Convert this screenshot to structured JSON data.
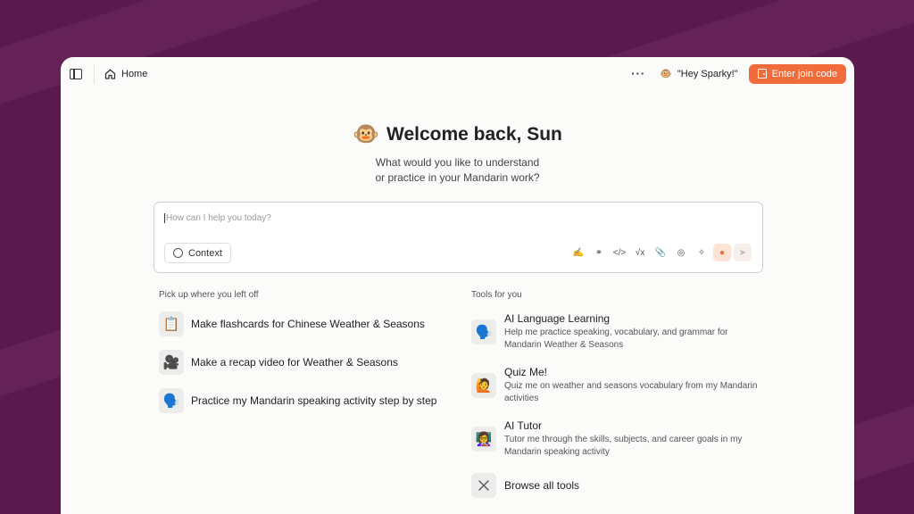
{
  "topbar": {
    "home_label": "Home",
    "more_label": "···",
    "sparky_label": "\"Hey Sparky!\"",
    "join_button_label": "Enter join code"
  },
  "hero": {
    "title": "Welcome back, Sun",
    "subtitle_line1": "What would you like to understand",
    "subtitle_line2": "or practice in your Mandarin work?"
  },
  "chat": {
    "placeholder": "How can I help you today?",
    "context_label": "Context",
    "tools": [
      "handwriting-icon",
      "brain-icon",
      "code-icon",
      "formula-icon",
      "paperclip-icon",
      "camera-icon",
      "magic-wand-icon",
      "microphone-icon",
      "send-icon"
    ]
  },
  "pickup": {
    "label": "Pick up where you left off",
    "items": [
      {
        "emoji": "📋",
        "text": "Make flashcards for Chinese Weather & Seasons"
      },
      {
        "emoji": "🎥",
        "text": "Make a recap video for Weather & Seasons"
      },
      {
        "emoji": "🗣️",
        "text": "Practice my Mandarin speaking activity step by step"
      }
    ]
  },
  "tools": {
    "label": "Tools for you",
    "items": [
      {
        "emoji": "🗣️",
        "name": "AI Language Learning",
        "desc": "Help me practice speaking, vocabulary, and grammar for Mandarin Weather & Seasons"
      },
      {
        "emoji": "🙋",
        "name": "Quiz Me!",
        "desc": "Quiz me on weather and seasons vocabulary from my Mandarin activities"
      },
      {
        "emoji": "👩‍🏫",
        "name": "AI Tutor",
        "desc": "Tutor me through the skills, subjects, and career goals in my Mandarin speaking activity"
      }
    ],
    "browse_label": "Browse all tools"
  },
  "colors": {
    "accent": "#f26b3a",
    "background": "#5a1a4d"
  }
}
